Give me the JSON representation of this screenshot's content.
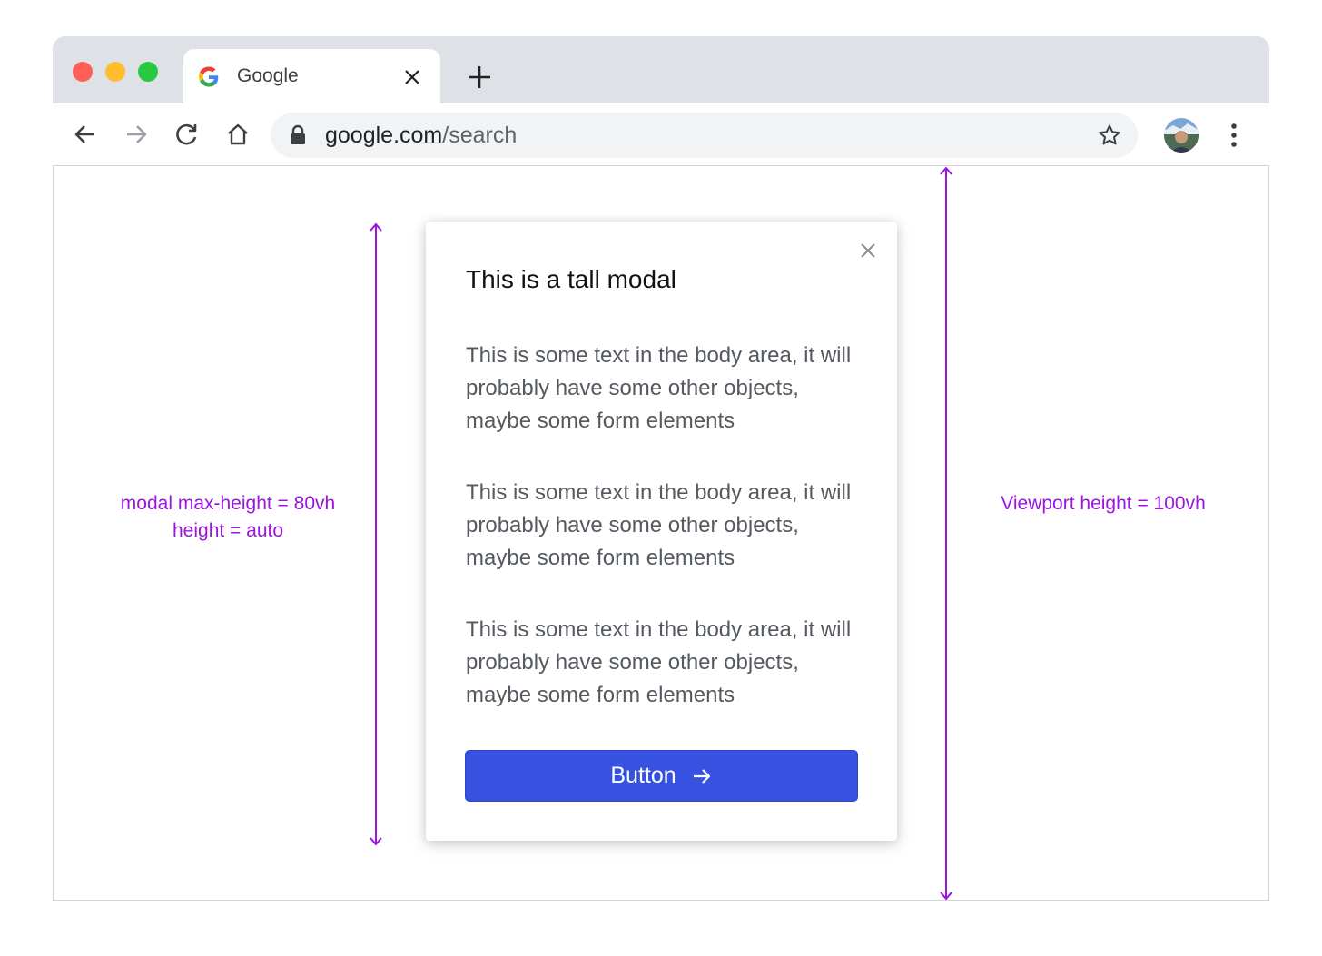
{
  "tab": {
    "title": "Google",
    "favicon": "google-g-icon"
  },
  "omnibox": {
    "domain": "google.com",
    "path": "/search"
  },
  "modal": {
    "title": "This is a tall modal",
    "paragraphs": [
      "This is some text in the body area, it will probably have some other objects, maybe some form elements",
      "This is some text in the body area, it will probably have some other objects, maybe some form elements",
      "This is some text in the body area, it will probably have some other objects, maybe some form elements"
    ],
    "button_label": "Button"
  },
  "annotations": {
    "left_line1": "modal max-height = 80vh",
    "left_line2": "height = auto",
    "right": "Viewport height = 100vh"
  },
  "colors": {
    "annotation": "#9b14e0",
    "button": "#3751e0",
    "tabstrip": "#dee1e6"
  }
}
